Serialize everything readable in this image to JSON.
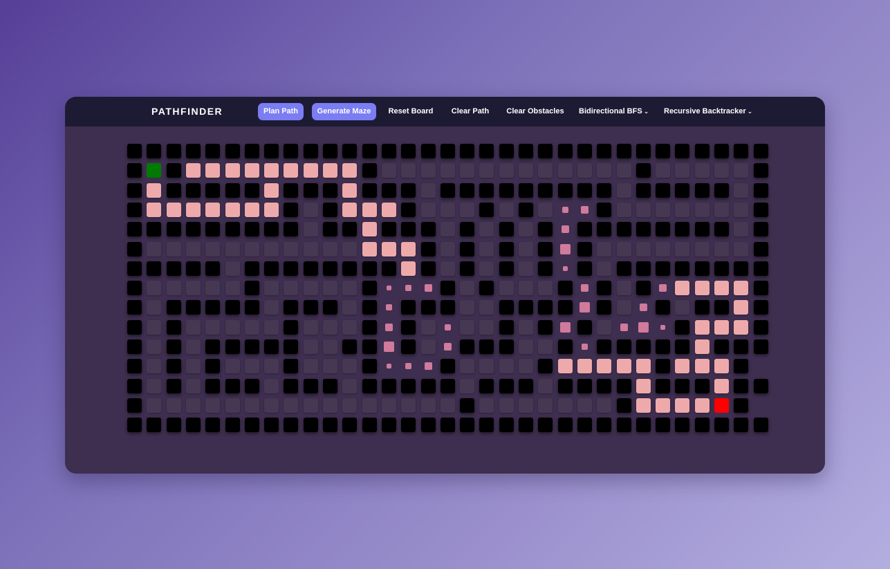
{
  "brand": "PATHFINDER",
  "nav": {
    "plan_path": "Plan Path",
    "generate_maze": "Generate Maze",
    "reset_board": "Reset Board",
    "clear_path": "Clear Path",
    "clear_obstacles": "Clear Obstacles",
    "algorithm": "Bidirectional BFS",
    "maze_algorithm": "Recursive Backtracker"
  },
  "colors": {
    "wall": "#000000",
    "empty": "#463753",
    "path": "#eeaaaa",
    "visited": "#d07a9c",
    "start": "#007a00",
    "end": "#ff0000",
    "accent": "#7b7df3",
    "navbar": "#1d1b33",
    "panel": "#3e2e4f"
  },
  "icons": {
    "dropdown": "chevron-down-icon"
  },
  "grid": {
    "rows": 15,
    "cols": 33,
    "legend": "W=wall, .=empty, P=path, S=start, E=end, v=visited",
    "cells": [
      "WWWWWWWWWWWWWWWWWWWWWWWWWWWWWWWWW",
      "WSWPPPPPPPPPW.............W.....W",
      "WPWWWWWPWWWPWWW.WWWWWWWWW.WWWWW.W",
      "WPPPPPPPW.WPPPW...W.W.vvW.......W",
      "WWWWWWWWW.WWPWWW.W.W.WvWWWWWWWW.W",
      "W...........PPPW.W.W.WvW........W",
      "WWWWW.WWWWWWWWPW.W.W.WvW.WWWWWWWW",
      "W.....W.....WvvvW.W...WvW.WvPPPPW",
      "W.WWWWW.WWW.WvWWW..WWWWvW.vW.WWPW",
      "W.W.....W...WvW.v..W.WvW.vvvWPPPW",
      "W.W.WWWWW..WWvW.vWWW..WvWWWWWPWWW",
      "W.W.W...W...WvvvW....WPPPPPWPPPW",
      "W.W.WWW.WWW.WWWWW.WWW.WWWWPWWWPWW",
      "W................W.......WPPPPEW",
      "WWWWWWWWWWWWWWWWWWWWWWWWWWWWWWWWW"
    ]
  }
}
